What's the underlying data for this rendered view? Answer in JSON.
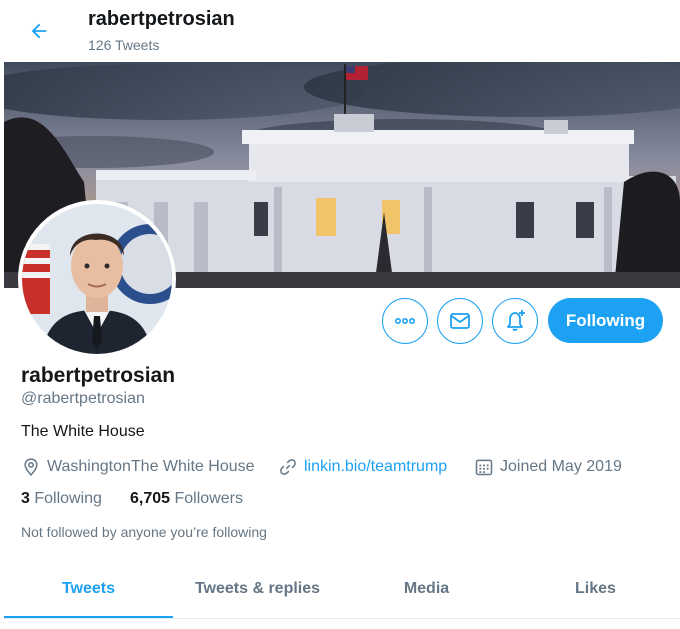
{
  "header": {
    "title": "rabertpetrosian",
    "tweet_count": "126 Tweets"
  },
  "profile": {
    "display_name": "rabertpetrosian",
    "handle": "@rabertpetrosian",
    "bio": "The White House",
    "location": "WashingtonThe White House",
    "website": "linkin.bio/teamtrump",
    "joined": "Joined May 2019",
    "following_count": "3",
    "following_label": "Following",
    "followers_count": "6,705",
    "followers_label": "Followers",
    "not_followed": "Not followed by anyone you’re following"
  },
  "actions": {
    "follow_label": "Following",
    "more_icon": "more-icon",
    "message_icon": "mail-icon",
    "notify_icon": "bell-plus-icon"
  },
  "tabs": [
    {
      "label": "Tweets",
      "active": true
    },
    {
      "label": "Tweets & replies",
      "active": false
    },
    {
      "label": "Media",
      "active": false
    },
    {
      "label": "Likes",
      "active": false
    }
  ],
  "colors": {
    "accent": "#1da1f2",
    "text": "#14171a",
    "muted": "#657786"
  }
}
